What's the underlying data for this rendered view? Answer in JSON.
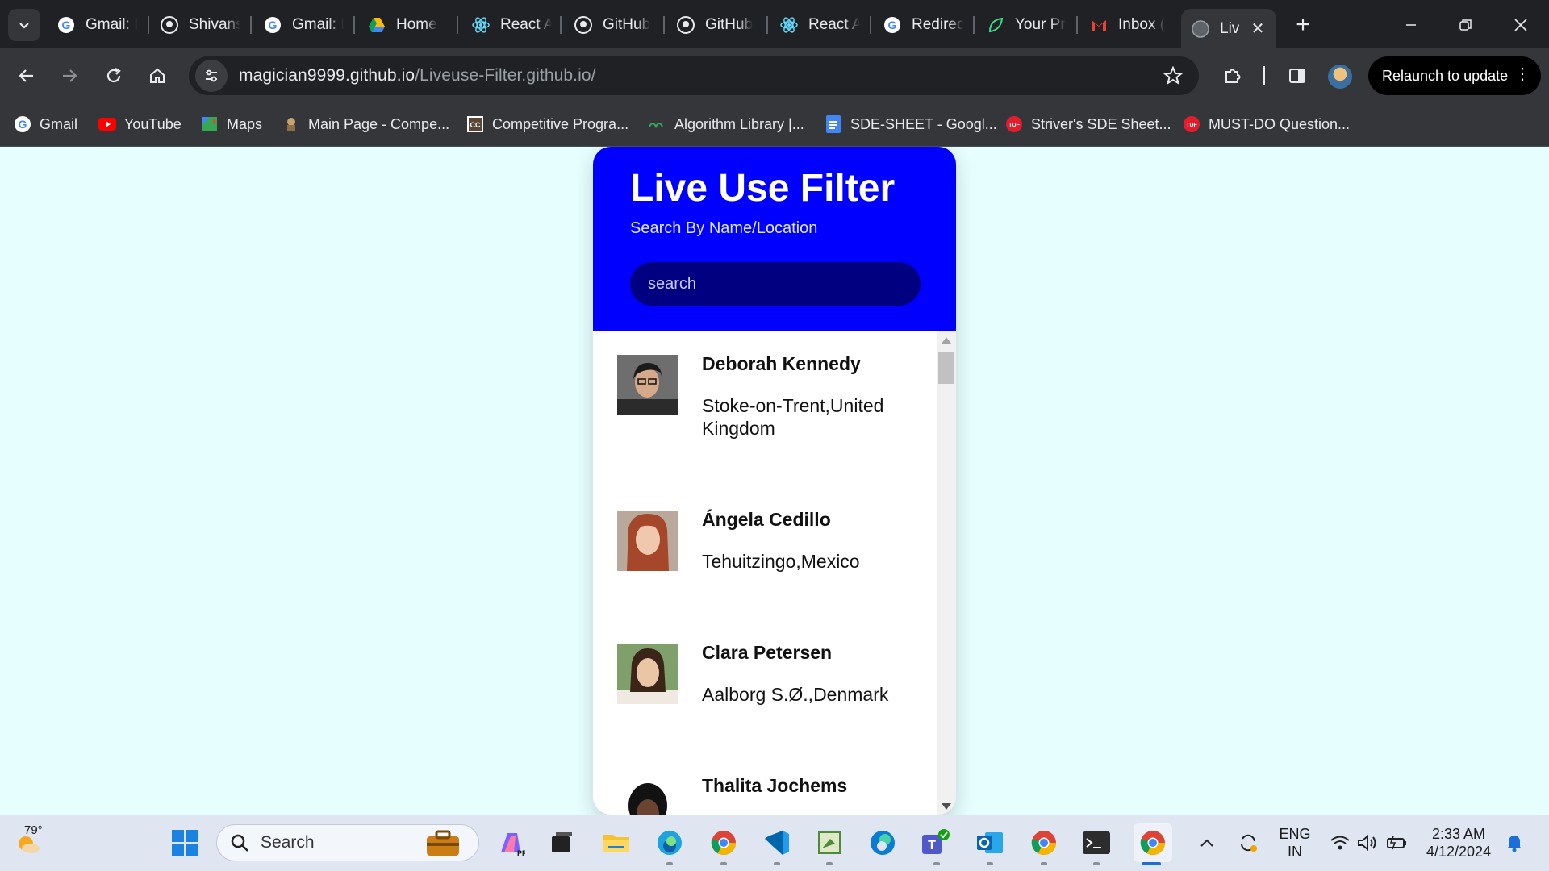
{
  "browser": {
    "tabs": [
      {
        "title": "Gmail: I",
        "icon": "google-icon"
      },
      {
        "title": "Shivans",
        "icon": "github-icon"
      },
      {
        "title": "Gmail: I",
        "icon": "google-icon"
      },
      {
        "title": "Home",
        "icon": "google-drive-icon"
      },
      {
        "title": "React A",
        "icon": "react-icon"
      },
      {
        "title": "GitHub",
        "icon": "github-icon"
      },
      {
        "title": "GitHub",
        "icon": "github-icon"
      },
      {
        "title": "React A",
        "icon": "react-icon"
      },
      {
        "title": "Redirec",
        "icon": "google-icon"
      },
      {
        "title": "Your Pr",
        "icon": "leaf-icon"
      },
      {
        "title": "Inbox (",
        "icon": "gmail-icon"
      },
      {
        "title": "Liv",
        "icon": "globe-icon",
        "active": true
      }
    ],
    "url": {
      "domain": "magician9999.github.io",
      "path": "/Liveuse-Filter.github.io/"
    },
    "relaunch_label": "Relaunch to update",
    "bookmarks": [
      {
        "label": "Gmail",
        "icon": "google-icon"
      },
      {
        "label": "YouTube",
        "icon": "youtube-icon"
      },
      {
        "label": "Maps",
        "icon": "maps-icon"
      },
      {
        "label": "Main Page - Compe...",
        "icon": "wiki-icon"
      },
      {
        "label": "Competitive Progra...",
        "icon": "cc-icon"
      },
      {
        "label": "Algorithm Library |...",
        "icon": "algo-icon"
      },
      {
        "label": "SDE-SHEET - Googl...",
        "icon": "docs-icon"
      },
      {
        "label": "Striver's SDE Sheet...",
        "icon": "tuf-icon"
      },
      {
        "label": "MUST-DO Question...",
        "icon": "tuf-icon"
      }
    ]
  },
  "app": {
    "title": "Live Use Filter",
    "subtitle": "Search By Name/Location",
    "search_placeholder": "search",
    "users": [
      {
        "name": "Deborah Kennedy",
        "location": "Stoke-on-Trent,United Kingdom"
      },
      {
        "name": "Ángela Cedillo",
        "location": "Tehuitzingo,Mexico"
      },
      {
        "name": "Clara Petersen",
        "location": "Aalborg S.Ø.,Denmark"
      },
      {
        "name": "Thalita Jochems",
        "location": ""
      }
    ],
    "colors": {
      "header": "#0000ff",
      "search_bg": "#000080",
      "page_bg": "#e6fffe"
    }
  },
  "taskbar": {
    "weather": "79°",
    "search_label": "Search",
    "lang_line1": "ENG",
    "lang_line2": "IN",
    "time": "2:33 AM",
    "date": "4/12/2024"
  }
}
